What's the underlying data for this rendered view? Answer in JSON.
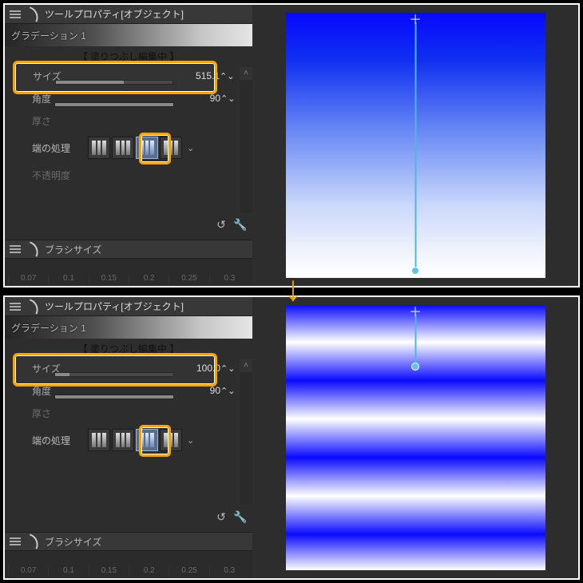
{
  "top": {
    "title": "ツールプロパティ[オブジェクト]",
    "sub_header": "グラデーション 1",
    "editing_label": "【 塗りつぶし編集中 】",
    "size_label": "サイズ",
    "size_value": "515.1",
    "angle_label": "角度",
    "angle_value": "90",
    "thickness_label": "厚さ",
    "edge_label": "端の処理",
    "opacity_label": "不透明度",
    "brush_panel_label": "ブラシサイズ",
    "ticks": [
      "0.07",
      "0.1",
      "0.15",
      "0.2",
      "0.25",
      "0.3"
    ],
    "stepper": "⌃⌄"
  },
  "bottom": {
    "title": "ツールプロパティ[オブジェクト]",
    "sub_header": "グラデーション 1",
    "editing_label": "【 塗りつぶし編集中 】",
    "size_label": "サイズ",
    "size_value": "100.0",
    "angle_label": "角度",
    "angle_value": "90",
    "thickness_label": "厚さ",
    "edge_label": "端の処理",
    "brush_panel_label": "ブラシサイズ",
    "ticks": [
      "0.07",
      "0.1",
      "0.15",
      "0.2",
      "0.25",
      "0.3"
    ],
    "stepper": "⌃⌄"
  },
  "icons": {
    "menu": "≡",
    "brush": "",
    "up": "˄ ",
    "down": "˅",
    "chev": "⌄",
    "clock": "↺",
    "wrench": "🔧",
    "plus": "＋"
  },
  "arrow_glyph": "↓"
}
